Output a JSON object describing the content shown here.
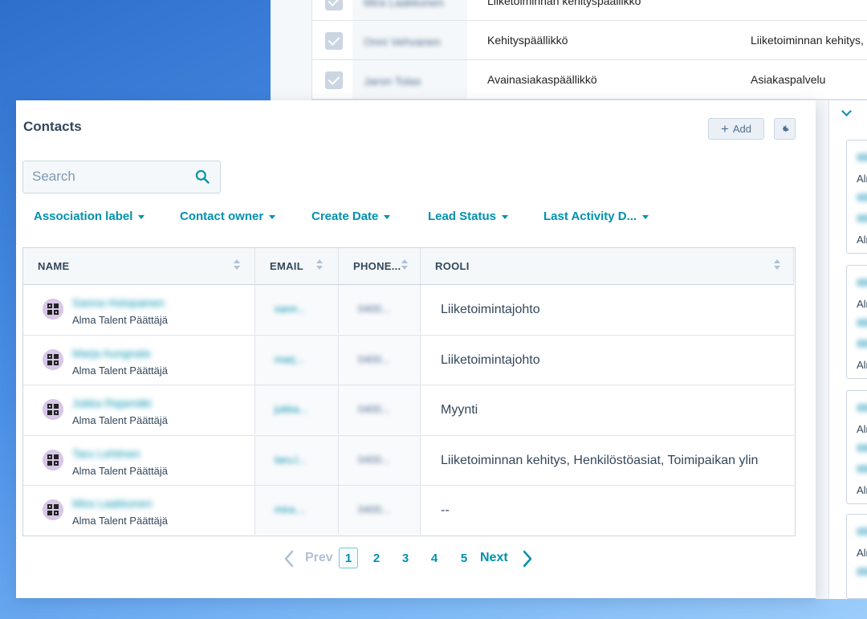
{
  "background_table": {
    "rows": [
      {
        "name": "Mira Laakkonen",
        "title": "Liiketoiminnan kehityspäällikkö",
        "dept": ""
      },
      {
        "name": "Onni Vehvanen",
        "title": "Kehityspäällikkö",
        "dept": "Liiketoiminnan kehitys, H"
      },
      {
        "name": "Jaron Tolas",
        "title": "Avainasiakaspäällikkö",
        "dept": "Asiakaspalvelu"
      }
    ]
  },
  "contacts": {
    "title": "Contacts",
    "add_label": "Add",
    "search_placeholder": "Search",
    "filters": [
      "Association label",
      "Contact owner",
      "Create Date",
      "Lead Status",
      "Last Activity D..."
    ],
    "columns": [
      "NAME",
      "EMAIL",
      "PHONE...",
      "ROOLI"
    ],
    "rows": [
      {
        "name": "Sanna Holopainen",
        "company": "Alma Talent Päättäjä",
        "email": "sann...",
        "phone": "0400...",
        "role": "Liiketoimintajohto"
      },
      {
        "name": "Marja Aungnala",
        "company": "Alma Talent Päättäjä",
        "email": "marj...",
        "phone": "0400...",
        "role": "Liiketoimintajohto"
      },
      {
        "name": "Jukka Rajamäki",
        "company": "Alma Talent Päättäjä",
        "email": "jukka...",
        "phone": "0400...",
        "role": "Myynti"
      },
      {
        "name": "Taru Lehtinen",
        "company": "Alma Talent Päättäjä",
        "email": "taru.l...",
        "phone": "0400...",
        "role": "Liiketoiminnan kehitys, Henkilöstöasiat, Toimipaikan ylin"
      },
      {
        "name": "Mira Laakkonen",
        "company": "Alma Talent Päättäjä",
        "email": "mira....",
        "phone": "0400...",
        "role": "--"
      }
    ],
    "pagination": {
      "prev": "Prev",
      "next": "Next",
      "pages": [
        "1",
        "2",
        "3",
        "4",
        "5"
      ],
      "current": "1"
    }
  },
  "right_panel": {
    "cards": [
      {
        "lines": [
          "Alr",
          "Alr"
        ]
      },
      {
        "lines": [
          "Alr",
          "Alr"
        ]
      },
      {
        "lines": [
          "Alr",
          "Alr"
        ]
      },
      {
        "lines": [
          "Alr"
        ]
      }
    ]
  },
  "colors": {
    "accent": "#0091ae",
    "text": "#33475b",
    "border": "#cbd6e2",
    "panel_bg": "#f5f8fa"
  }
}
